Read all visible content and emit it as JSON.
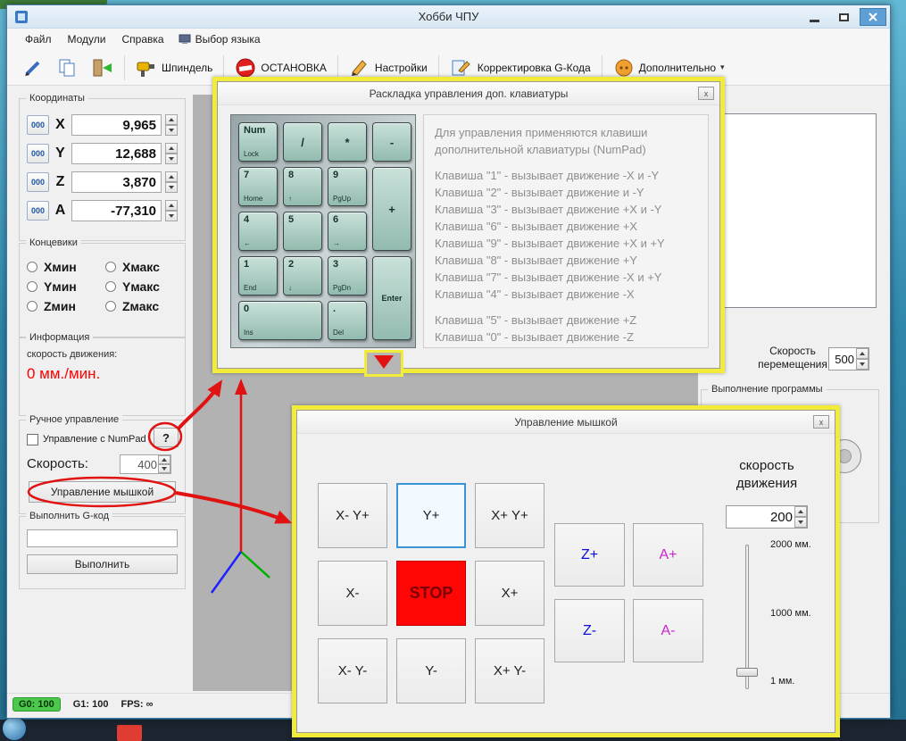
{
  "window": {
    "title": "Хобби ЧПУ"
  },
  "menu": {
    "items": [
      "Файл",
      "Модули",
      "Справка",
      "Выбор языка"
    ]
  },
  "toolbar": {
    "spindle": "Шпиндель",
    "stop": "ОСТАНОВКА",
    "settings": "Настройки",
    "gcode": "Корректировка G-Кода",
    "additional": "Дополнительно",
    "caret": "▾"
  },
  "left": {
    "coordinates": {
      "title": "Координаты",
      "zero": "000",
      "axes": [
        {
          "label": "X",
          "value": "9,965"
        },
        {
          "label": "Y",
          "value": "12,688"
        },
        {
          "label": "Z",
          "value": "3,870"
        },
        {
          "label": "A",
          "value": "-77,310"
        }
      ]
    },
    "limits": {
      "title": "Концевики",
      "items": [
        "Xмин",
        "Xмакс",
        "Yмин",
        "Yмакс",
        "Zмин",
        "Zмакс"
      ]
    },
    "info": {
      "title": "Информация",
      "speed_label": "скорость движения:",
      "speed_value": "0 мм./мин."
    },
    "manual": {
      "title": "Ручное управление",
      "numpad_label": "Управление с NumPad",
      "help": "?",
      "speed_label": "Скорость:",
      "speed_value": "400",
      "mouse_button": "Управление мышкой"
    },
    "gcode": {
      "title": "Выполнить G-код",
      "input_value": "",
      "run": "Выполнить"
    }
  },
  "right": {
    "move_speed_line1": "Скорость",
    "move_speed_line2": "перемещения",
    "move_speed_value": "500",
    "program_title": "Выполнение программы"
  },
  "status": {
    "g0": "G0: 100",
    "g1": "G1: 100",
    "fps": "FPS: ∞"
  },
  "numpad_dialog": {
    "title": "Раскладка управления доп. клавиатуры",
    "close": "x",
    "intro": "Для управления применяются клавиши дополнительной клавиатуры (NumPad)",
    "keys": [
      {
        "t": "Num",
        "b": "Lock"
      },
      {
        "t": "/",
        "b": ""
      },
      {
        "t": "*",
        "b": ""
      },
      {
        "t": "-",
        "b": ""
      },
      {
        "t": "7",
        "b": "Home"
      },
      {
        "t": "8",
        "b": "↑"
      },
      {
        "t": "9",
        "b": "PgUp"
      },
      {
        "t": "+",
        "b": ""
      },
      {
        "t": "4",
        "b": "←"
      },
      {
        "t": "5",
        "b": ""
      },
      {
        "t": "6",
        "b": "→"
      },
      {
        "t": "1",
        "b": "End"
      },
      {
        "t": "2",
        "b": "↓"
      },
      {
        "t": "3",
        "b": "PgDn"
      },
      {
        "t": "Enter",
        "b": ""
      },
      {
        "t": "0",
        "b": "Ins"
      },
      {
        "t": ".",
        "b": "Del"
      }
    ],
    "lines": [
      "Клавиша \"1\" - вызывает движение -X и -Y",
      "Клавиша \"2\" - вызывает движение и -Y",
      "Клавиша \"3\" - вызывает движение +X и -Y",
      "Клавиша \"6\" - вызывает движение +X",
      "Клавиша \"9\" - вызывает движение +X и +Y",
      "Клавиша \"8\" - вызывает движение +Y",
      "Клавиша \"7\" - вызывает движение -X и +Y",
      "Клавиша \"4\" - вызывает движение -X"
    ],
    "lines2": [
      "Клавиша \"5\" - вызывает движение +Z",
      "Клавиша \"0\" - вызывает движение -Z"
    ]
  },
  "mouse_dialog": {
    "title": "Управление мышкой",
    "close": "x",
    "grid": [
      "X- Y+",
      "Y+",
      "X+ Y+",
      "X-",
      "STOP",
      "X+",
      "X- Y-",
      "Y-",
      "X+ Y-"
    ],
    "za": [
      "Z+",
      "A+",
      "Z-",
      "A-"
    ],
    "speed_line1": "скорость",
    "speed_line2": "движения",
    "speed_value": "200",
    "slider_labels": [
      "2000 мм.",
      "1000 мм.",
      "1 мм."
    ]
  }
}
